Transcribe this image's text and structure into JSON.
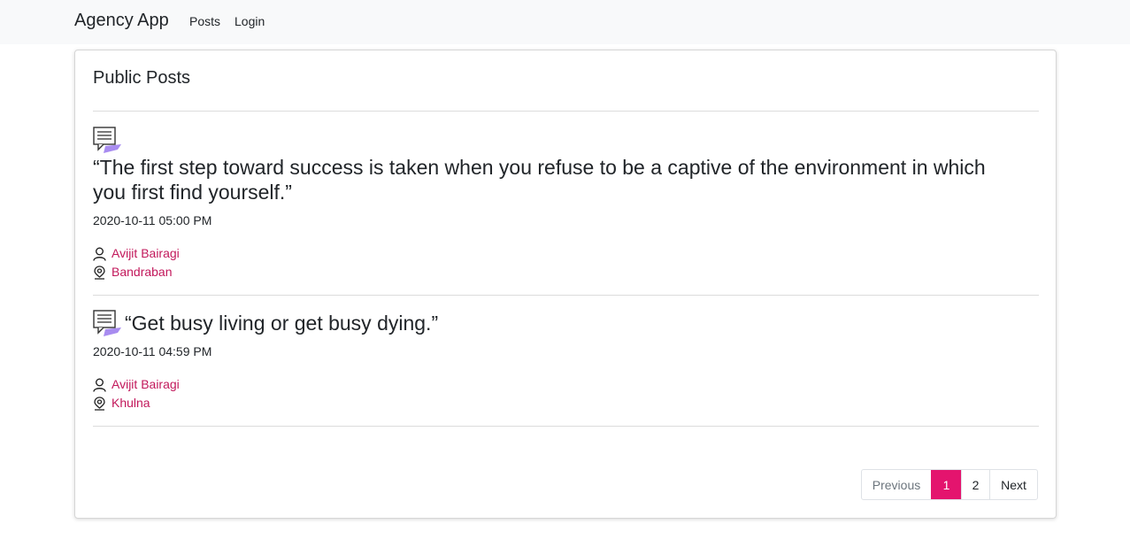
{
  "navbar": {
    "brand": "Agency App",
    "links": [
      {
        "label": "Posts"
      },
      {
        "label": "Login"
      }
    ]
  },
  "card": {
    "title": "Public Posts"
  },
  "posts": [
    {
      "quote_line1": "“The first step toward success is taken when you refuse to be a captive of the environment in which",
      "quote_line2": "you first find yourself.”",
      "date": "2020-10-11 05:00 PM",
      "author": "Avijit Bairagi",
      "location": "Bandraban"
    },
    {
      "quote": "“Get busy living or get busy dying.”",
      "date": "2020-10-11 04:59 PM",
      "author": "Avijit Bairagi",
      "location": "Khulna"
    }
  ],
  "pagination": {
    "previous": "Previous",
    "pages": [
      "1",
      "2"
    ],
    "next": "Next",
    "active_page": "1"
  },
  "colors": {
    "accent": "#e4146e",
    "link": "#c2185b",
    "icon_purple": "#a88cf0"
  },
  "icons": {
    "post": "chat-message-icon",
    "author": "user-icon",
    "location": "location-pin-icon"
  }
}
